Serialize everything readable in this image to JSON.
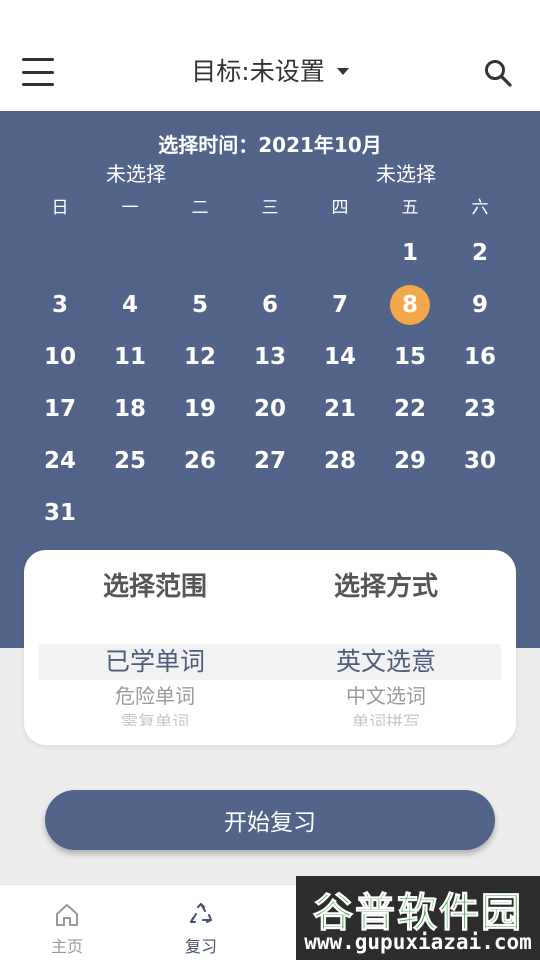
{
  "header": {
    "title": "目标:未设置",
    "menu_icon": "hamburger-menu-icon",
    "search_icon": "search-icon"
  },
  "calendar": {
    "select_time_label": "选择时间：2021年10月",
    "unselected_left": "未选择",
    "unselected_right": "未选择",
    "weekdays": [
      "日",
      "一",
      "二",
      "三",
      "四",
      "五",
      "六"
    ],
    "weeks": [
      [
        "",
        "",
        "",
        "",
        "",
        "1",
        "2"
      ],
      [
        "3",
        "4",
        "5",
        "6",
        "7",
        "8",
        "9"
      ],
      [
        "10",
        "11",
        "12",
        "13",
        "14",
        "15",
        "16"
      ],
      [
        "17",
        "18",
        "19",
        "20",
        "21",
        "22",
        "23"
      ],
      [
        "24",
        "25",
        "26",
        "27",
        "28",
        "29",
        "30"
      ],
      [
        "31",
        "",
        "",
        "",
        "",
        "",
        ""
      ]
    ],
    "selected_day": "8",
    "selected_color": "#f3a84e"
  },
  "picker": {
    "range_header": "选择范围",
    "method_header": "选择方式",
    "range_options": [
      "已学单词",
      "危险单词",
      "需复单词"
    ],
    "method_options": [
      "英文选意",
      "中文选词",
      "单词拼写"
    ]
  },
  "start_button": {
    "label": "开始复习"
  },
  "bottom_nav": {
    "items": [
      {
        "label": "主页",
        "icon": "home-icon"
      },
      {
        "label": "复习",
        "icon": "recycle-icon"
      }
    ]
  },
  "watermark": {
    "title": "谷普软件园",
    "url": "www.gupuxiazai.com"
  },
  "colors": {
    "primary": "#526489",
    "accent": "#f3a84e",
    "background": "#ececec"
  }
}
